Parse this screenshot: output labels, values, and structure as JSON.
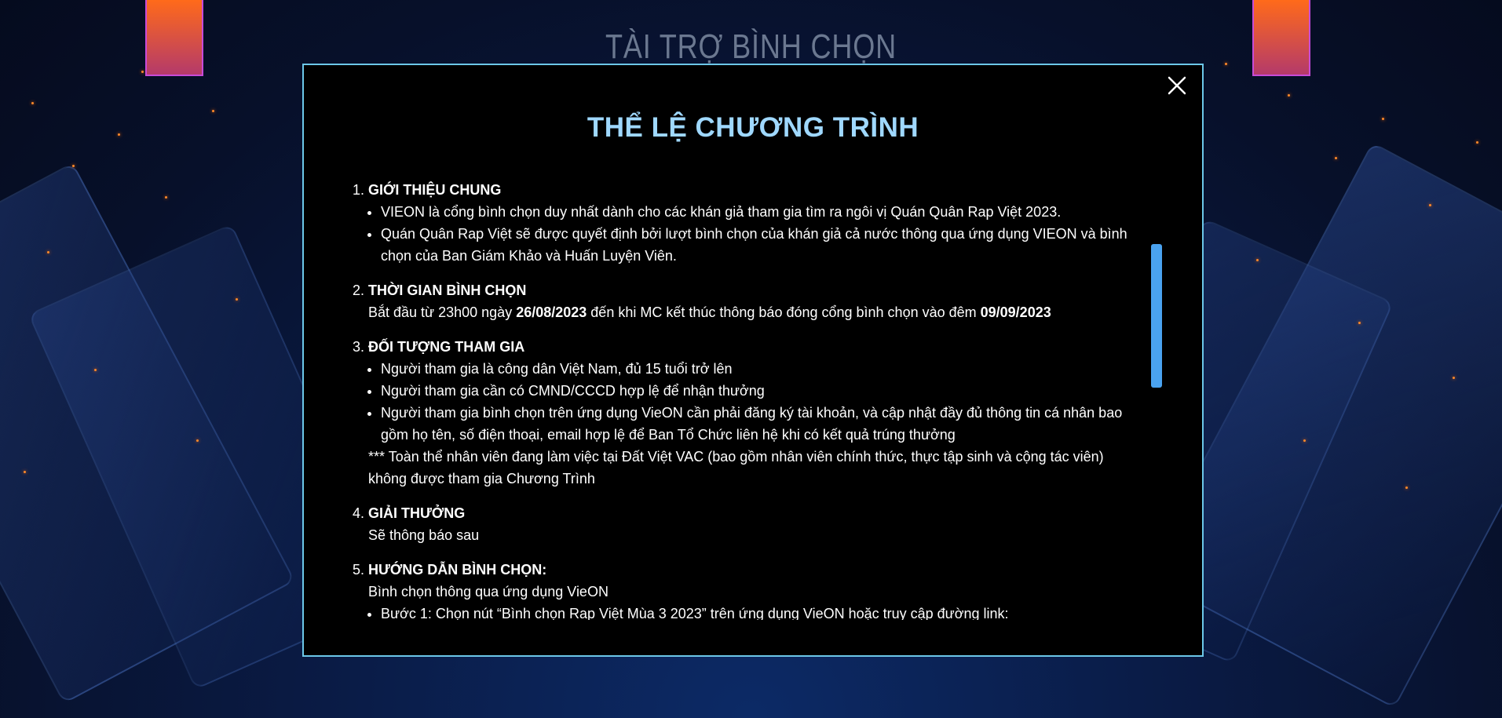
{
  "page": {
    "background_title": "TÀI TRỢ BÌNH CHỌN"
  },
  "colors": {
    "title": "#9fd8ff",
    "modal_border": "#6cc7e8",
    "scrollbar_thumb": "#4aa3f0"
  },
  "modal": {
    "title": "THỂ LỆ CHƯƠNG TRÌNH",
    "close_icon": "close-icon",
    "sections": [
      {
        "number": "1.",
        "heading": "GIỚI THIỆU CHUNG",
        "bullets": [
          "VIEON là cổng bình chọn duy nhất dành cho các khán giả tham gia tìm ra ngôi vị Quán Quân Rap Việt 2023.",
          "Quán Quân Rap Việt sẽ được quyết định bởi lượt bình chọn của khán giả cả nước thông qua ứng dụng VIEON và bình chọn của Ban Giám Khảo và Huấn Luyện Viên."
        ]
      },
      {
        "number": "2.",
        "heading": "THỜI GIAN BÌNH CHỌN",
        "text_parts": [
          "Bắt đầu từ 23h00 ngày ",
          "26/08/2023",
          " đến khi MC kết thúc thông báo đóng cổng bình chọn vào đêm ",
          "09/09/2023"
        ]
      },
      {
        "number": "3.",
        "heading": "ĐỐI TƯỢNG THAM GIA",
        "bullets": [
          "Người tham gia là công dân Việt Nam, đủ 15 tuổi trở lên",
          "Người tham gia cần có CMND/CCCD hợp lệ để nhận thưởng",
          "Người tham gia bình chọn trên ứng dụng VieON cần phải đăng ký tài khoản, và cập nhật đầy đủ thông tin cá nhân bao gồm họ tên, số điện thoại, email hợp lệ để Ban Tổ Chức liên hệ khi có kết quả trúng thưởng"
        ],
        "note": "*** Toàn thể nhân viên đang làm việc tại Đất Việt VAC (bao gồm nhân viên chính thức, thực tập sinh và cộng tác viên) không được tham gia Chương Trình"
      },
      {
        "number": "4.",
        "heading": "GIẢI THƯỞNG",
        "text": "Sẽ thông báo sau"
      },
      {
        "number": "5.",
        "heading": "HƯỚNG DẪN BÌNH CHỌN:",
        "text": "Bình chọn thông qua ứng dụng VieON",
        "bullets": [
          "Bước 1: Chọn nút “Bình chọn Rap Việt Mùa 3 2023” trên ứng dụng VieON hoặc truy cập đường link:"
        ]
      }
    ]
  }
}
